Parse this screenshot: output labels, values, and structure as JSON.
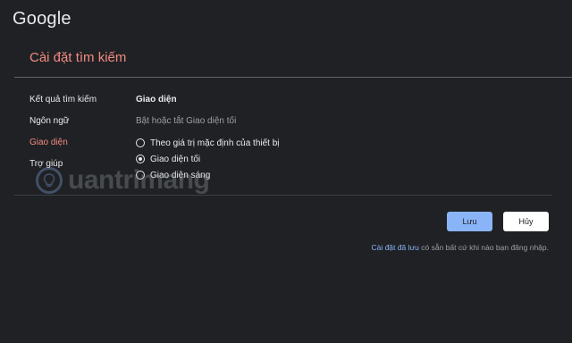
{
  "header": {
    "logo_text": "Google"
  },
  "page": {
    "title": "Cài đặt tìm kiếm"
  },
  "sidebar": {
    "items": [
      {
        "label": "Kết quả tìm kiếm"
      },
      {
        "label": "Ngôn ngữ"
      },
      {
        "label": "Giao diện"
      },
      {
        "label": "Trợ giúp"
      }
    ],
    "active_index": 2
  },
  "appearance": {
    "title": "Giao diện",
    "description": "Bật hoặc tắt Giao diện tối",
    "options": [
      {
        "label": "Theo giá trị mặc định của thiết bị",
        "checked": false
      },
      {
        "label": "Giao diện tối",
        "checked": true
      },
      {
        "label": "Giao diện sáng",
        "checked": false
      }
    ]
  },
  "actions": {
    "save_label": "Lưu",
    "cancel_label": "Hủy"
  },
  "footer": {
    "link_text": "Cài đặt đã lưu",
    "text": " có sẵn bất cứ khi nào bạn đăng nhập."
  },
  "watermark": {
    "text": "uantrimang"
  },
  "colors": {
    "background": "#202124",
    "accent": "#f28b82",
    "link": "#8ab4f8"
  }
}
